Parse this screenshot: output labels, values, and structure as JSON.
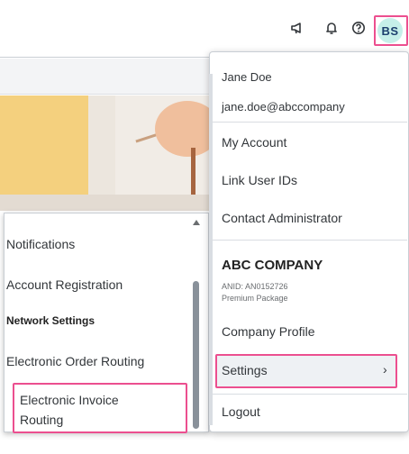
{
  "topbar": {
    "icons": [
      "megaphone-icon",
      "bell-icon",
      "help-icon"
    ],
    "avatar_initials": "BS"
  },
  "account_menu": {
    "user_name": "Jane Doe",
    "user_email": "jane.doe@abccompany",
    "items": [
      "My Account",
      "Link User IDs",
      "Contact Administrator"
    ],
    "company": {
      "name": "ABC COMPANY",
      "anid": "ANID: AN0152726",
      "package": "Premium Package"
    },
    "company_items": [
      "Company Profile",
      "Settings"
    ],
    "logout": "Logout"
  },
  "settings_submenu": {
    "items_top": [
      "Notifications",
      "Account Registration"
    ],
    "section_heading": "Network Settings",
    "items_network": [
      "Electronic Order Routing",
      "Electronic Invoice Routing"
    ]
  },
  "colors": {
    "highlight": "#ec4f8f",
    "avatar_bg": "#c6efe9",
    "avatar_text": "#1c3f6e"
  }
}
